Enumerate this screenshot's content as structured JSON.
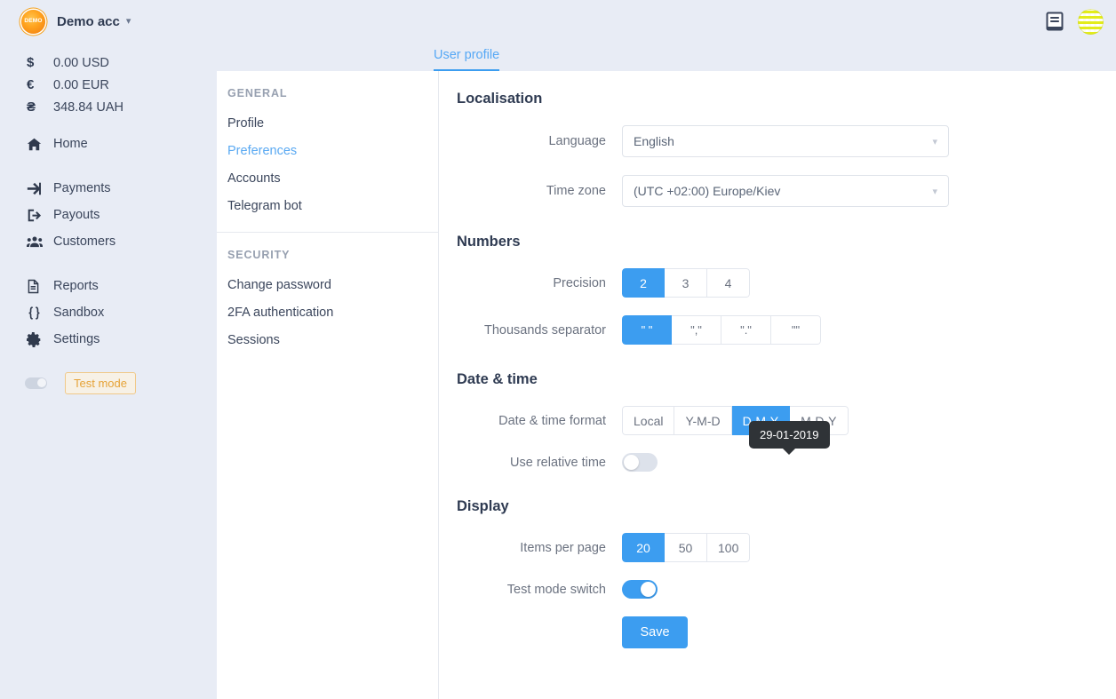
{
  "sidebar": {
    "brand": {
      "logo_text": "DEMO",
      "account_name": "Demo acc",
      "caret": "chevron-down"
    },
    "balances": [
      {
        "symbol": "$",
        "amount": "0.00 USD"
      },
      {
        "symbol": "€",
        "amount": "0.00 EUR"
      },
      {
        "symbol": "₴",
        "amount": "348.84 UAH"
      }
    ],
    "nav_primary": [
      {
        "icon": "home-icon",
        "label": "Home"
      }
    ],
    "nav_secondary": [
      {
        "icon": "payments-icon",
        "label": "Payments"
      },
      {
        "icon": "payouts-icon",
        "label": "Payouts"
      },
      {
        "icon": "customers-icon",
        "label": "Customers"
      }
    ],
    "nav_tertiary": [
      {
        "icon": "reports-icon",
        "label": "Reports"
      },
      {
        "icon": "sandbox-icon",
        "label": "Sandbox"
      },
      {
        "icon": "settings-icon",
        "label": "Settings"
      }
    ],
    "test_mode": {
      "label": "Test mode",
      "enabled": false
    }
  },
  "topbar": {
    "docs_icon": "book-icon",
    "avatar": "user-avatar"
  },
  "tabs": [
    {
      "label": "User profile",
      "active": true
    }
  ],
  "subnav": {
    "groups": [
      {
        "title": "GENERAL",
        "items": [
          {
            "label": "Profile",
            "active": false
          },
          {
            "label": "Preferences",
            "active": true
          },
          {
            "label": "Accounts",
            "active": false
          },
          {
            "label": "Telegram bot",
            "active": false
          }
        ]
      },
      {
        "title": "SECURITY",
        "items": [
          {
            "label": "Change password",
            "active": false
          },
          {
            "label": "2FA authentication",
            "active": false
          },
          {
            "label": "Sessions",
            "active": false
          }
        ]
      }
    ]
  },
  "form": {
    "localisation": {
      "title": "Localisation",
      "language": {
        "label": "Language",
        "value": "English"
      },
      "timezone": {
        "label": "Time zone",
        "value": "(UTC +02:00) Europe/Kiev"
      }
    },
    "numbers": {
      "title": "Numbers",
      "precision": {
        "label": "Precision",
        "options": [
          "2",
          "3",
          "4"
        ],
        "selected": "2"
      },
      "thousands_separator": {
        "label": "Thousands separator",
        "options": [
          "\" \"",
          "\",\"",
          "\".\"",
          "\"\""
        ],
        "selected": "\" \""
      }
    },
    "datetime": {
      "title": "Date & time",
      "format": {
        "label": "Date & time format",
        "options": [
          "Local",
          "Y-M-D",
          "D-M-Y",
          "M-D-Y"
        ],
        "selected": "D-M-Y"
      },
      "tooltip": "29-01-2019",
      "relative_time": {
        "label": "Use relative time",
        "enabled": false
      }
    },
    "display": {
      "title": "Display",
      "items_per_page": {
        "label": "Items per page",
        "options": [
          "20",
          "50",
          "100"
        ],
        "selected": "20"
      },
      "test_mode_switch": {
        "label": "Test mode switch",
        "enabled": true
      }
    },
    "save_label": "Save"
  },
  "colors": {
    "accent": "#3c9df0",
    "sidebar_bg": "#e8ecf5",
    "tooltip_bg": "#2f3337",
    "test_mode_orange": "#e6a338"
  }
}
